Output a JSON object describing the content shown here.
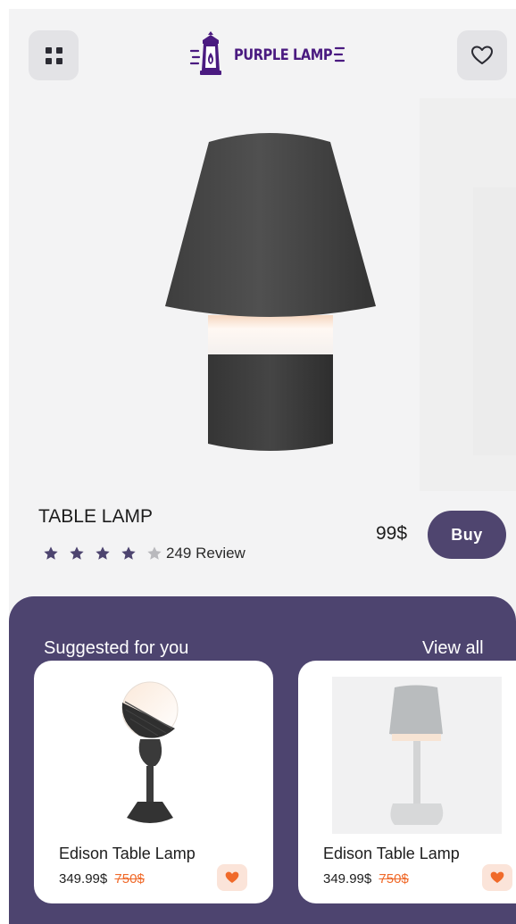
{
  "header": {
    "menu_icon": "grid-icon",
    "logo_text": "PURPLE LAMP",
    "favorite_icon": "heart-outline-icon"
  },
  "product": {
    "title": "TABLE LAMP",
    "rating": 4,
    "rating_max": 5,
    "reviews": "249 Review",
    "price": "99$",
    "buy_label": "Buy"
  },
  "suggested": {
    "title": "Suggested for you",
    "view_all": "View all",
    "items": [
      {
        "name": "Edison Table Lamp",
        "price": "349.99$",
        "old_price": "750$",
        "icon": "heart-filled-icon"
      },
      {
        "name": "Edison Table Lamp",
        "price": "349.99$",
        "old_price": "750$",
        "icon": "heart-filled-icon"
      }
    ]
  },
  "colors": {
    "brand_purple": "#4d446f",
    "logo_purple": "#4a1a80",
    "accent_orange": "#f06a2a",
    "background": "#f3f3f4"
  }
}
